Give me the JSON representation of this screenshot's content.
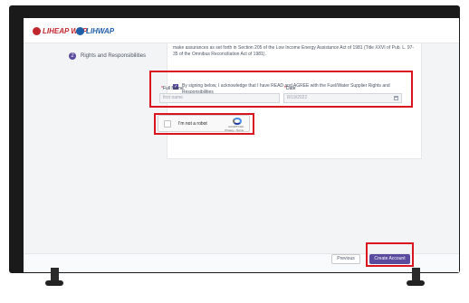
{
  "header": {
    "logo_left_text": "LIHEAP WAP",
    "logo_right_text": "LIHWAP"
  },
  "sidebar": {
    "steps": [
      {
        "number": "2",
        "label": "Rights and Responsibilities"
      }
    ]
  },
  "agreement": {
    "intro_text": "make assurances as set forth in Section 205 of the Low Income Energy Assistance Act of 1981 (Title XXVI of Pub. L. 97-35 of the Omnibus Reconciliation Act of 1981).",
    "ack_text": "By signing below, I acknowledge that I have READ and AGREE with the Fuel/Water Supplier Rights and Responsibilities"
  },
  "form": {
    "full_name_label": "Full Name",
    "full_name_placeholder": "first name",
    "date_label": "Date",
    "date_value": "8/19/2022",
    "required_mark": "*"
  },
  "captcha": {
    "label": "I'm not a robot",
    "brand": "reCAPTCHA",
    "links": "Privacy - Terms"
  },
  "footer": {
    "previous_label": "Previous",
    "create_label": "Create Account"
  },
  "colors": {
    "accent": "#5b4b9e",
    "highlight": "#d9141e"
  }
}
